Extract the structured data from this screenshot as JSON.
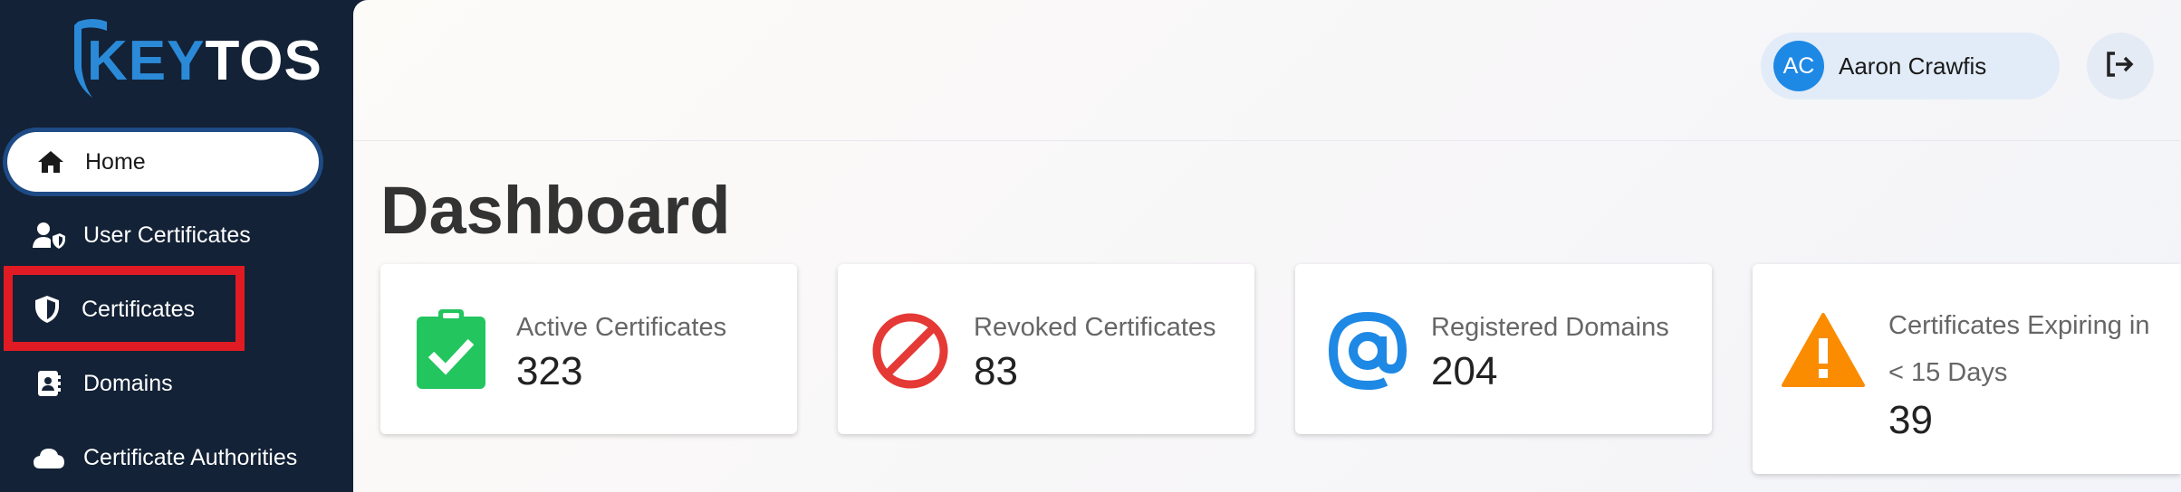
{
  "brand": {
    "logo_text_key": "KEY",
    "logo_text_rest": "TOS",
    "accent": "#2b8ad8",
    "sidebar_bg": "#132236"
  },
  "sidebar": {
    "items": [
      {
        "label": "Home",
        "icon": "home-icon",
        "active": true
      },
      {
        "label": "User Certificates",
        "icon": "user-shield-icon"
      },
      {
        "label": "Certificates",
        "icon": "shield-icon",
        "highlighted": true
      },
      {
        "label": "Domains",
        "icon": "address-book-icon"
      },
      {
        "label": "Certificate Authorities",
        "icon": "cloud-icon"
      }
    ]
  },
  "header": {
    "user": {
      "initials": "AC",
      "name": "Aaron Crawfis"
    },
    "logout_icon": "logout-icon"
  },
  "page": {
    "title": "Dashboard"
  },
  "cards": [
    {
      "label": "Active Certificates",
      "value": "323",
      "icon": "clipboard-check-icon",
      "color": "#22c55e"
    },
    {
      "label": "Revoked Certificates",
      "value": "83",
      "icon": "ban-icon",
      "color": "#e53935"
    },
    {
      "label": "Registered Domains",
      "value": "204",
      "icon": "at-icon",
      "color": "#1e88e5"
    },
    {
      "label": "Certificates Expiring in < 15 Days",
      "value": "39",
      "icon": "warning-icon",
      "color": "#fb8c00"
    }
  ]
}
